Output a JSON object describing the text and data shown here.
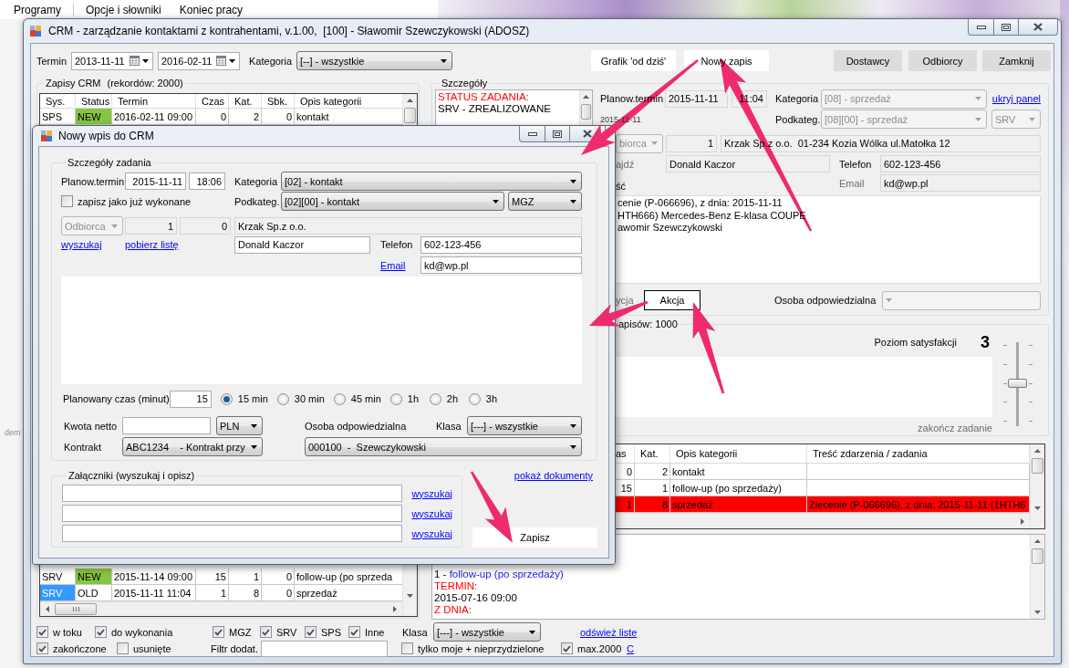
{
  "desktop": {
    "menu": [
      "Programy",
      "Opcje i słowniki",
      "Koniec pracy"
    ],
    "side_text": "dem"
  },
  "main_window": {
    "title": "CRM - zarządzanie kontaktami z kontrahentami, v.1.00,  [100] - Sławomir Szewczykowski (ADOSZ)",
    "filters": {
      "termin_label": "Termin",
      "date_from": "2013-11-11",
      "date_to": "2016-02-11",
      "kategoria_label": "Kategoria",
      "kategoria": {
        "value": "[--] - wszystkie",
        "disabled": false
      }
    },
    "buttons": [
      {
        "label": "Grafik 'od dziś'",
        "kind": "light"
      },
      {
        "label": "Nowy zapis",
        "kind": "light"
      },
      {
        "label": "Dostawcy",
        "kind": "normal"
      },
      {
        "label": "Odbiorcy",
        "kind": "normal"
      },
      {
        "label": "Zamknij",
        "kind": "normal"
      }
    ],
    "records": {
      "title": "Zapisy CRM",
      "count": "(rekordów: 2000)",
      "columns": [
        "Sys.",
        "Status",
        "Termin",
        "Czas",
        "Kat.",
        "Sbk.",
        "Opis kategorii"
      ],
      "rows_top": [
        {
          "cells": [
            "SPS",
            "NEW",
            "2016-02-11 09:00",
            "0",
            "2",
            "0",
            "kontakt"
          ],
          "color": "#86c540",
          "selected": false
        }
      ],
      "rows_bottom": [
        {
          "cells": [
            "SRV",
            "NEW",
            "2015-11-14 09:00",
            "15",
            "1",
            "0",
            "follow-up (po sprzeda"
          ],
          "color": "#86c540",
          "selected": false
        },
        {
          "cells": [
            "SRV",
            "OLD",
            "2015-11-11 11:04",
            "1",
            "8",
            "0",
            "sprzedaż"
          ],
          "selected": true
        }
      ]
    },
    "details": {
      "title": "Szczegóły",
      "notes": [
        {
          "text": "STATUS ZADANIA:",
          "kind": "label"
        },
        {
          "text": "SRV - ZREALIZOWANE",
          "kind": "value"
        }
      ],
      "planned_label": "Planow.termin",
      "planned_date": {
        "value": "2015-11-11",
        "readonly": true
      },
      "planned_time": {
        "value": "11:04",
        "readonly": true
      },
      "created_date": "2015-11-11",
      "kategoria_label": "Kategoria",
      "kategoria": {
        "value": "[08] - sprzedaż",
        "disabled": true
      },
      "hide_link": "ukryj panel",
      "podkateg_label": "Podkateg.",
      "podkateg": {
        "value": "[08][00] - sprzedaż",
        "disabled": true
      },
      "system": {
        "value": "SRV",
        "disabled": true
      },
      "party_type": {
        "value": "biorca",
        "disabled": true
      },
      "party_id": {
        "value": "1",
        "readonly": true
      },
      "party_name": {
        "value": "Krzak Sp.z o.o.  01-234 Kozia Wólka ul.Matołka 12",
        "readonly": true
      },
      "contact_label": {
        "text": "ajdź",
        "disabled": true
      },
      "contact": {
        "value": "Donald Kaczor",
        "readonly": true
      },
      "phone_label": {
        "text": "Telefon",
        "disabled": false
      },
      "phone": {
        "value": "602-123-456",
        "readonly": true
      },
      "content_label": {
        "text": "ść",
        "disabled": false
      },
      "email_label": {
        "text": "Email",
        "disabled": true
      },
      "email": {
        "value": "kd@wp.pl",
        "readonly": true
      },
      "content_lines": [
        "cenie (P-066696), z dnia: 2015-11-11",
        "HTH666) Mercedes-Benz E-klasa COUPE",
        "awomir Szewczykowski"
      ],
      "action_label": {
        "text": "ycja",
        "disabled": true
      },
      "action_button": "Akcja",
      "owner_label": {
        "text": "Osoba odpowiedzialna",
        "disabled": false
      },
      "owner": {
        "disabled": true
      }
    },
    "summary": {
      "title": "apisów: 1000",
      "label": "Poziom satysfakcji",
      "value": "3",
      "level": 0.5,
      "finish": {
        "text": "zakończ zadanie",
        "disabled": true
      }
    },
    "tasks": {
      "columns": [
        "as",
        "Kat.",
        "Opis kategorii",
        "Treść zdarzenia / zadania"
      ],
      "rows": [
        {
          "cells": [
            "0",
            "2",
            "kontakt"
          ]
        },
        {
          "cells": [
            "15",
            "1",
            "follow-up (po sprzedaży)"
          ]
        },
        {
          "cells": [
            "1",
            "8",
            "sprzedaż",
            "Zlecenie (P-066696), z dnia: 2015-11-11 (1HTH6"
          ],
          "color": "#ff0000"
        }
      ]
    },
    "log": {
      "lines": [
        {
          "kind": "entry",
          "prefix": "1 -",
          "text": "follow-up (po sprzedaży)"
        },
        {
          "kind": "label",
          "text": "TERMIN:"
        },
        {
          "kind": "value",
          "text": "2015-07-16 09:00"
        },
        {
          "kind": "label",
          "text": "Z DNIA:"
        }
      ]
    },
    "bottom_bar": {
      "upper": [
        {
          "kind": "checkbox",
          "label": "w toku",
          "checked": true
        },
        {
          "kind": "checkbox",
          "label": "do wykonania",
          "checked": true
        },
        {
          "kind": "checkbox",
          "label": "MGZ",
          "checked": true
        },
        {
          "kind": "checkbox",
          "label": "SRV",
          "checked": true
        },
        {
          "kind": "checkbox",
          "label": "SPS",
          "checked": true
        },
        {
          "kind": "checkbox",
          "label": "Inne",
          "checked": true
        },
        {
          "kind": "label",
          "text": "Klasa"
        },
        {
          "kind": "combo",
          "value": "[---] - wszystkie",
          "disabled": false
        },
        {
          "kind": "link",
          "text": "odśwież liste"
        }
      ],
      "lower": [
        {
          "kind": "checkbox",
          "label": "zakończone",
          "checked": true
        },
        {
          "kind": "checkbox",
          "label": "usunięte",
          "checked": false
        },
        {
          "kind": "label",
          "text": "Filtr dodat."
        },
        {
          "kind": "input"
        },
        {
          "kind": "checkbox",
          "label": "tylko moje + nieprzydzielone",
          "checked": false
        },
        {
          "kind": "checkbox",
          "label": "max.2000",
          "checked": true
        },
        {
          "kind": "link",
          "text": "C"
        }
      ]
    }
  },
  "dialog": {
    "title": "Nowy wpis do CRM",
    "group_title": "Szczegóły zadania",
    "planned_label": "Planow.termin",
    "planned_date": {
      "value": "2015-11-11",
      "readonly": false
    },
    "planned_time": {
      "value": "18:06",
      "readonly": false
    },
    "kategoria_label": "Kategoria",
    "kategoria": {
      "value": "[02] - kontakt",
      "disabled": false
    },
    "done": {
      "label": "zapisz jako już wykonane",
      "checked": false
    },
    "podkateg_label": "Podkateg.",
    "podkateg": {
      "value": "[02][00] - kontakt",
      "disabled": false
    },
    "system": {
      "value": "MGZ",
      "disabled": false
    },
    "party_type": {
      "value": "Odbiorca",
      "disabled": true
    },
    "party_id": {
      "value": "1",
      "readonly": true
    },
    "party_sub": {
      "value": "0",
      "readonly": true
    },
    "party_name": {
      "value": "Krzak Sp.z o.o.",
      "readonly": true
    },
    "search_link": "wyszukaj",
    "list_link": "pobierz listę",
    "contact": {
      "value": "Donald Kaczor",
      "readonly": false
    },
    "phone_label": "Telefon",
    "phone": {
      "value": "602-123-456",
      "readonly": false
    },
    "email_link": "Email",
    "email": {
      "value": "kd@wp.pl",
      "readonly": false
    },
    "duration_label": "Planowany czas (minut)",
    "duration": {
      "value": "15",
      "readonly": false
    },
    "duration_options": [
      {
        "label": "15 min",
        "selected": true
      },
      {
        "label": "30 min",
        "selected": false
      },
      {
        "label": "45 min",
        "selected": false
      },
      {
        "label": "1h",
        "selected": false
      },
      {
        "label": "2h",
        "selected": false
      },
      {
        "label": "3h",
        "selected": false
      }
    ],
    "amount_label": "Kwota netto",
    "amount": {
      "readonly": false
    },
    "currency": {
      "value": "PLN",
      "disabled": false
    },
    "owner_label": "Osoba odpowiedzialna",
    "class_label": "Klasa",
    "class": {
      "value": "[---] - wszystkie",
      "disabled": false
    },
    "contract_label": "Kontrakt",
    "contract": {
      "value": "ABC1234    - Kontrakt przy",
      "disabled": false
    },
    "owner": {
      "value": "000100  -  Szewczykowski",
      "disabled": false
    },
    "attachments_title": "Załączniki (wyszukaj i opisz)",
    "attachments": [
      {
        "link": "wyszukaj"
      },
      {
        "link": "wyszukaj"
      },
      {
        "link": "wyszukaj"
      }
    ],
    "documents_link": "pokaż dokumenty",
    "save_button": "Zapisz"
  }
}
